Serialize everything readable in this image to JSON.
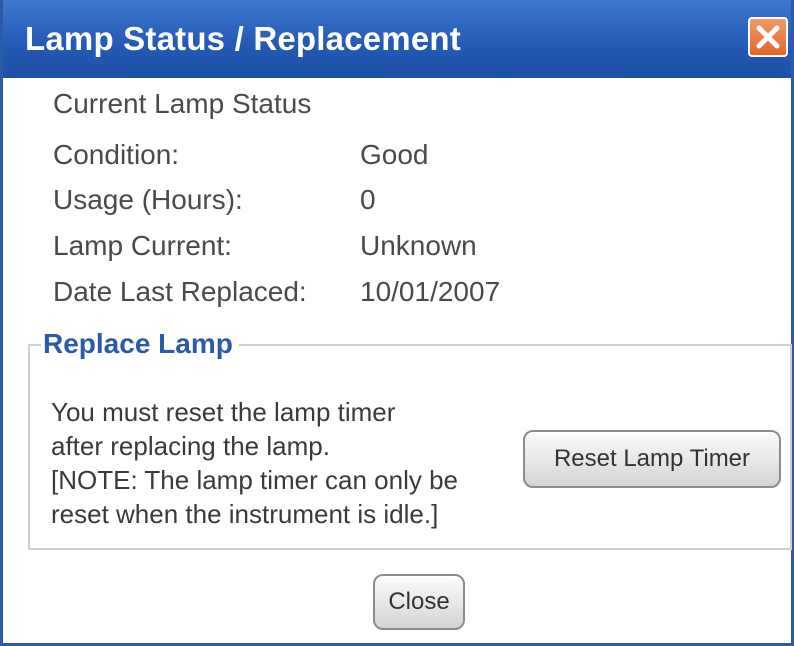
{
  "window": {
    "title": "Lamp Status / Replacement"
  },
  "status": {
    "heading": "Current Lamp Status",
    "fields": [
      {
        "label": "Condition:",
        "value": "Good"
      },
      {
        "label": "Usage (Hours):",
        "value": "0"
      },
      {
        "label": "Lamp Current:",
        "value": "Unknown"
      },
      {
        "label": "Date Last Replaced:",
        "value": "10/01/2007"
      }
    ]
  },
  "replace": {
    "legend": "Replace Lamp",
    "note_lines": [
      "You must reset the lamp timer",
      "after replacing the lamp.",
      "[NOTE: The lamp timer can only be",
      "reset when the instrument is idle.]"
    ],
    "reset_button_label": "Reset Lamp Timer"
  },
  "footer": {
    "close_button_label": "Close"
  },
  "icons": {
    "close": "close-icon"
  },
  "colors": {
    "titlebar": "#2358b4",
    "legend_text": "#2a5aa8",
    "close_button": "#e0672b"
  }
}
